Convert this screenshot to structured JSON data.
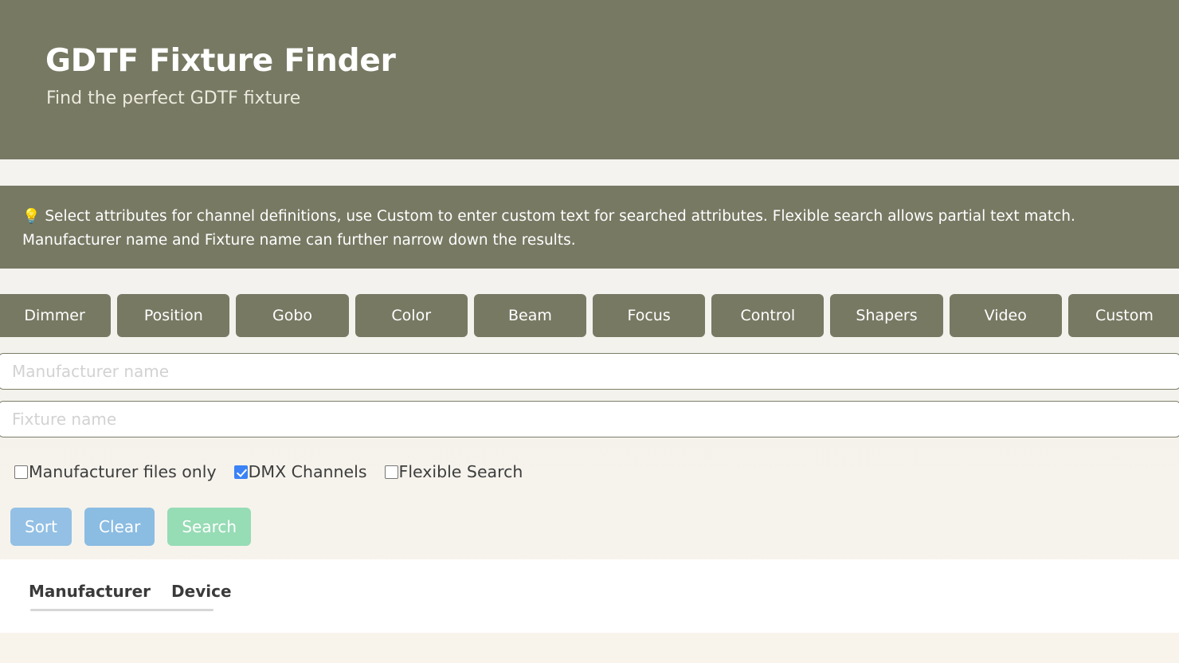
{
  "header": {
    "title": "GDTF Fixture Finder",
    "subtitle": "Find the perfect GDTF fixture"
  },
  "info_banner": {
    "icon": "lightbulb-icon",
    "icon_glyph": "💡",
    "text": "Select attributes for channel definitions, use Custom to enter custom text for searched attributes. Flexible search allows partial text match. Manufacturer name and Fixture name can further narrow down the results."
  },
  "attribute_buttons": [
    {
      "label": "Dimmer"
    },
    {
      "label": "Position"
    },
    {
      "label": "Gobo"
    },
    {
      "label": "Color"
    },
    {
      "label": "Beam"
    },
    {
      "label": "Focus"
    },
    {
      "label": "Control"
    },
    {
      "label": "Shapers"
    },
    {
      "label": "Video"
    },
    {
      "label": "Custom"
    }
  ],
  "fields": {
    "manufacturer": {
      "placeholder": "Manufacturer name",
      "value": ""
    },
    "fixture": {
      "placeholder": "Fixture name",
      "value": ""
    }
  },
  "checkboxes": [
    {
      "label": "Manufacturer files only",
      "checked": false
    },
    {
      "label": "DMX Channels",
      "checked": true
    },
    {
      "label": "Flexible Search",
      "checked": false
    }
  ],
  "actions": [
    {
      "label": "Sort",
      "color": "#93c0e4"
    },
    {
      "label": "Clear",
      "color": "#8bbce2"
    },
    {
      "label": "Search",
      "color": "#96dcb5"
    }
  ],
  "result_tabs": [
    {
      "label": "Manufacturer",
      "active": true
    },
    {
      "label": "Device",
      "active": false
    }
  ],
  "colors": {
    "olive": "#777963",
    "page_background": "#f4f4f4",
    "panel_background": "#ffffff",
    "checkbox_accent": "#3b82f6",
    "tab_underline": "#d6d6d6"
  }
}
